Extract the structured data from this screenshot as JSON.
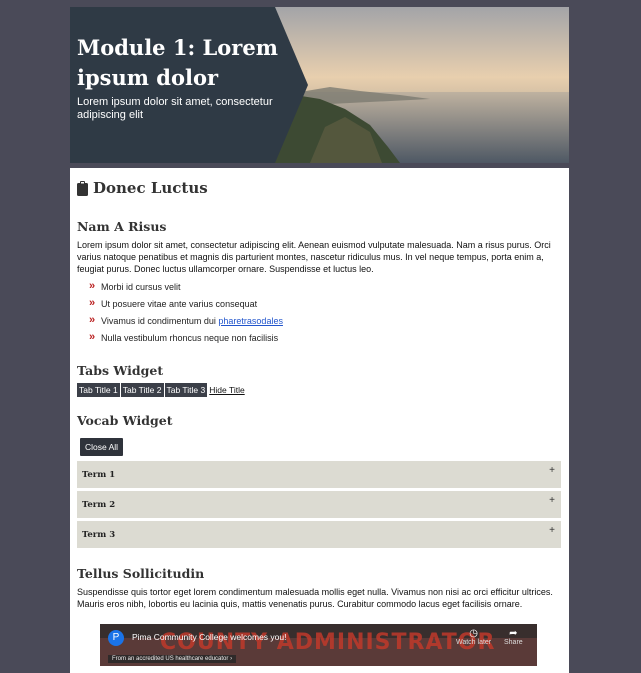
{
  "hero": {
    "title": "Module 1: Lorem ipsum dolor",
    "subtitle": "Lorem ipsum dolor sit amet, consectetur adipiscing elit"
  },
  "section": {
    "title": "Donec Luctus",
    "icon": "clipboard-icon"
  },
  "nam": {
    "heading": "Nam A Risus",
    "paragraph": "Lorem ipsum dolor sit amet, consectetur adipiscing elit. Aenean euismod vulputate malesuada. Nam a risus purus. Orci varius natoque penatibus et magnis dis parturient montes, nascetur ridiculus mus. In vel neque tempus, porta enim a, feugiat purus. Donec luctus ullamcorper ornare. Suspendisse et luctus leo.",
    "bullets": [
      "Morbi id cursus velit",
      "Ut posuere vitae ante varius consequat",
      "Vivamus id condimentum dui ",
      "Nulla vestibulum rhoncus neque non facilisis"
    ],
    "bullet_link": "pharetrasodales"
  },
  "tabs_widget": {
    "heading": "Tabs Widget",
    "tabs": [
      "Tab Title 1",
      "Tab Title 2",
      "Tab Title 3"
    ],
    "hide_label": "Hide Title"
  },
  "vocab_widget": {
    "heading": "Vocab Widget",
    "close_all": "Close All",
    "terms": [
      "Term 1",
      "Term 2",
      "Term 3"
    ],
    "expand_symbol": "+"
  },
  "tellus": {
    "heading": "Tellus Sollicitudin",
    "paragraph": "Suspendisse quis tortor eget lorem condimentum malesuada mollis eget nulla. Vivamus non nisi ac orci efficitur ultrices. Mauris eros nibh, lobortis eu lacinia quis, mattis venenatis purus. Curabitur commodo lacus eget facilisis ornare."
  },
  "video": {
    "channel_initial": "P",
    "title": "Pima Community College welcomes you!",
    "banner": "COUNTY ADMINISTRATOR",
    "watch_later": "Watch later",
    "share": "Share",
    "badge": "From an accredited US healthcare educator"
  },
  "colors": {
    "background": "#4a4a58",
    "panel": "#2f3a45",
    "tab": "#3b3f48",
    "term_bg": "#dcdbd2",
    "bullet": "#b22222",
    "link": "#2255cc"
  }
}
